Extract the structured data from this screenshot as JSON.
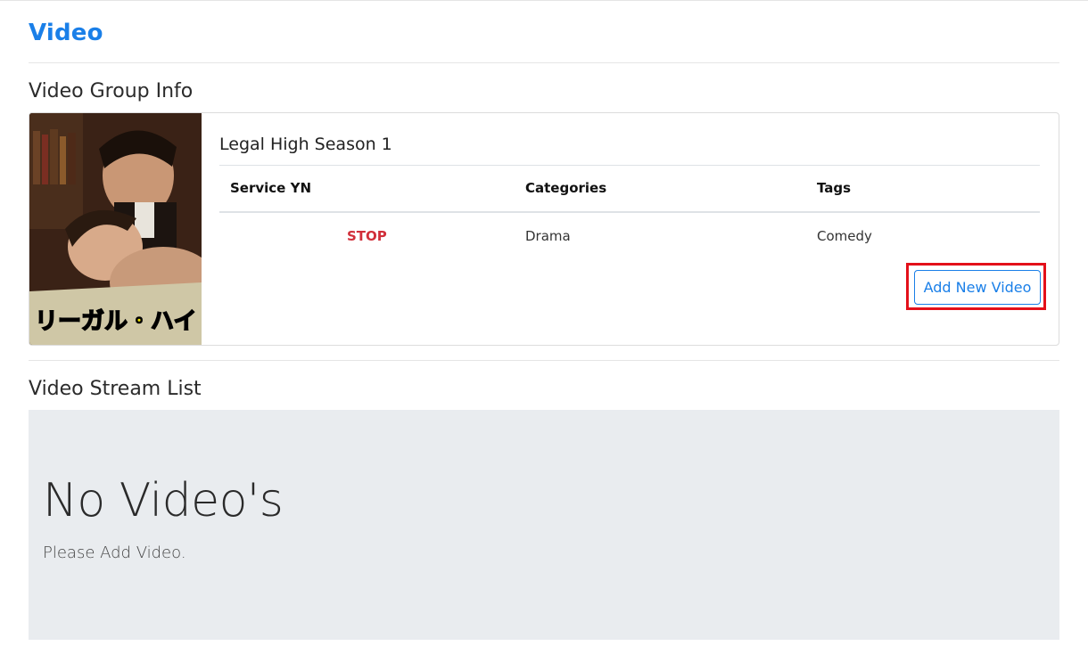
{
  "page": {
    "title": "Video"
  },
  "video_group": {
    "section_title": "Video Group Info",
    "name": "Legal High Season 1",
    "poster_icon": "video-poster-image",
    "poster_text": "リーガル・ハイ",
    "table": {
      "headers": [
        "Service YN",
        "Categories",
        "Tags"
      ],
      "row": {
        "service_yn": "STOP",
        "categories": "Drama",
        "tags": "Comedy"
      }
    },
    "add_button_label": "Add New Video"
  },
  "stream_list": {
    "section_title": "Video Stream List",
    "empty_title": "No Video's",
    "empty_message": "Please Add Video."
  },
  "colors": {
    "accent": "#1a7fe8",
    "status_stop": "#d12f3a",
    "highlight": "#e3101a",
    "jumbotron_bg": "#e9ecef"
  }
}
